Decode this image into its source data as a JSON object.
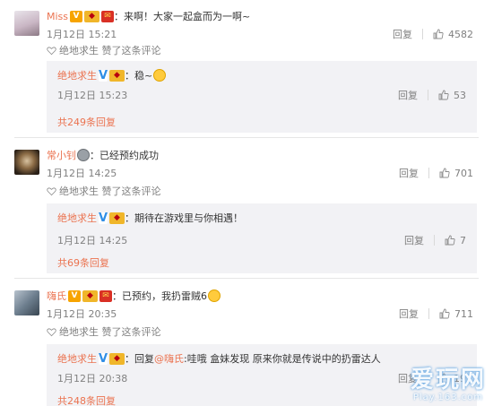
{
  "comments": [
    {
      "user": "Miss",
      "text": "：来啊！大家一起盒而为一啊~",
      "time": "1月12日 15:21",
      "reply_label": "回复",
      "likes": "4582",
      "liked_by": "绝地求生 赞了这条评论",
      "reply": {
        "user": "绝地求生",
        "text": "：稳~",
        "time": "1月12日 15:23",
        "reply_label": "回复",
        "likes": "53"
      },
      "more": "共249条回复"
    },
    {
      "user": "常小钊",
      "text": "：已经预约成功",
      "time": "1月12日 14:25",
      "reply_label": "回复",
      "likes": "701",
      "liked_by": "绝地求生 赞了这条评论",
      "reply": {
        "user": "绝地求生",
        "text": "：期待在游戏里与你相遇！",
        "time": "1月12日 14:25",
        "reply_label": "回复",
        "likes": "7"
      },
      "more": "共69条回复"
    },
    {
      "user": "嗨氏",
      "text": "：已预约，我扔雷贼6",
      "time": "1月12日 20:35",
      "reply_label": "回复",
      "likes": "711",
      "liked_by": "绝地求生 赞了这条评论",
      "reply": {
        "user": "绝地求生",
        "text_prefix": "：回复",
        "mention": "@嗨氏",
        "text": ":哇哦  盒妹发现  原来你就是传说中的扔雷达人",
        "time": "1月12日 20:38",
        "reply_label": "回复",
        "likes": "19"
      },
      "more": "共248条回复"
    }
  ],
  "watermark": {
    "main": "爱玩网",
    "sub": "Play.163.com"
  },
  "colors": {
    "accent": "#eb7350",
    "meta": "#808080",
    "reply_bg": "#f2f2f5",
    "verified": "#2f8ee6"
  }
}
